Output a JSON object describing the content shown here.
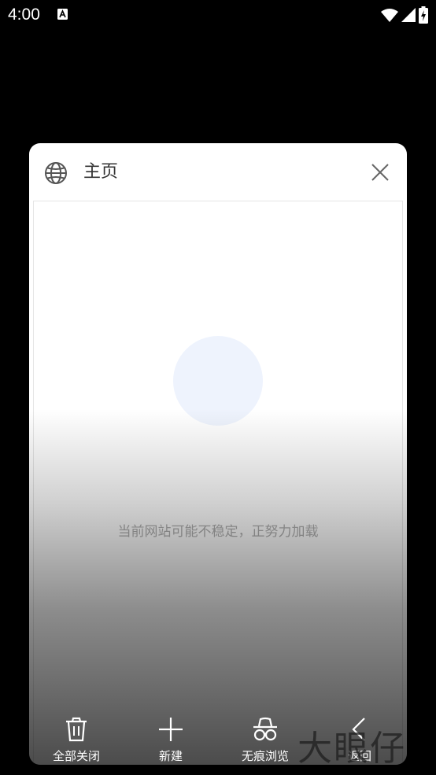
{
  "status_bar": {
    "time": "4:00"
  },
  "tab": {
    "title": "主页",
    "loading_text": "当前网站可能不稳定，正努力加载"
  },
  "toolbar": {
    "close_all_label": "全部关闭",
    "new_label": "新建",
    "incognito_label": "无痕浏览",
    "back_label": "返回"
  },
  "watermark": "大眼仔",
  "icons": {
    "status": [
      "a-notification-icon",
      "wifi-icon",
      "signal-icon",
      "battery-icon"
    ],
    "tab": [
      "globe-icon",
      "close-icon"
    ],
    "toolbar": [
      "trash-icon",
      "plus-icon",
      "incognito-icon",
      "back-arrow-icon"
    ]
  },
  "colors": {
    "background": "#000000",
    "card": "#ffffff",
    "loading_circle": "#eef3fd",
    "loading_text": "#b0b0b0"
  }
}
